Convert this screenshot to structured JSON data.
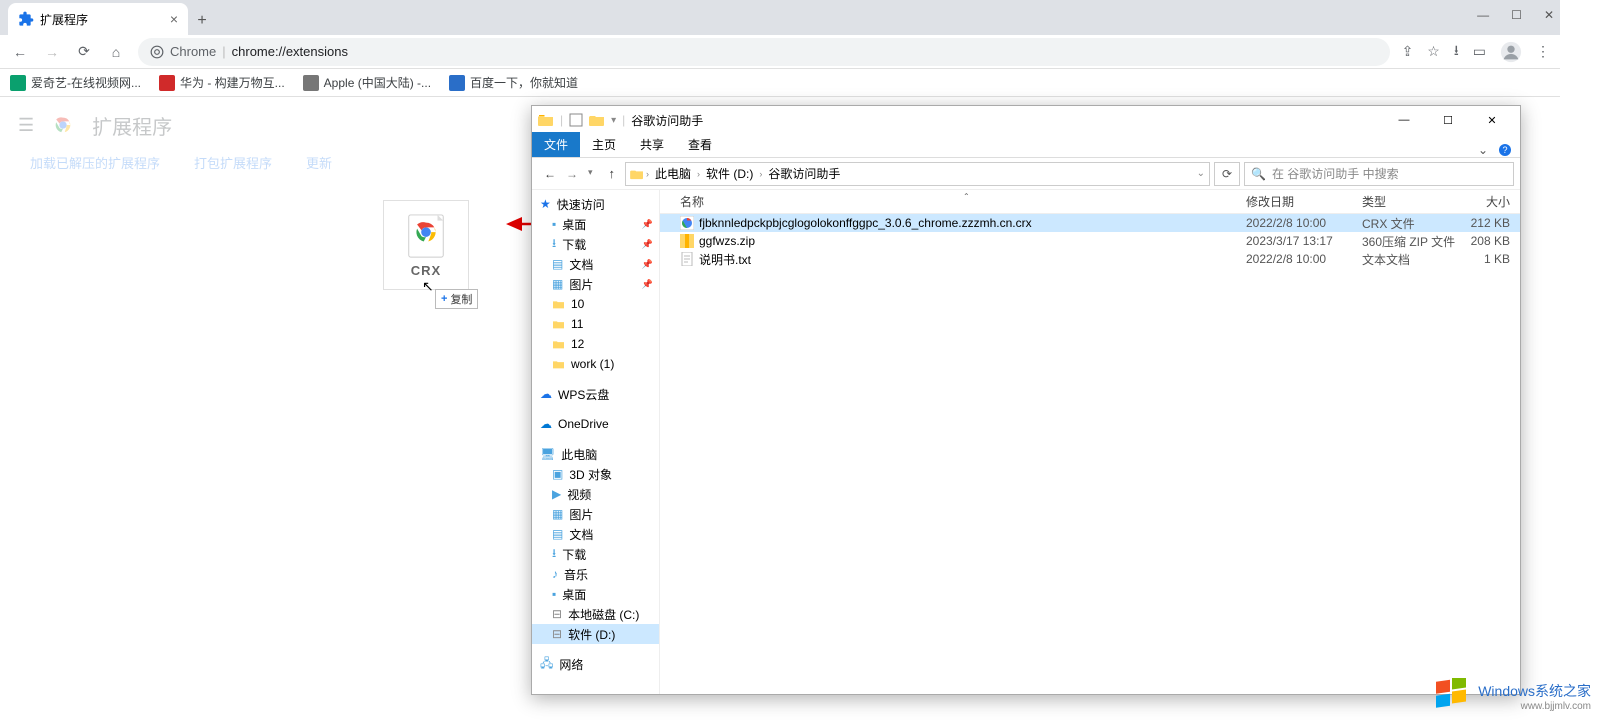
{
  "chrome": {
    "tab_title": "扩展程序",
    "omnibox_prefix": "Chrome",
    "omnibox_url": "chrome://extensions",
    "bookmarks": [
      {
        "label": "爱奇艺-在线视频网...",
        "color": "#0aa06e"
      },
      {
        "label": "华为 - 构建万物互...",
        "color": "#d02a2a"
      },
      {
        "label": "Apple (中国大陆) -...",
        "color": "#777"
      },
      {
        "label": "百度一下，你就知道",
        "color": "#2a6ec8"
      }
    ],
    "ext_page_title": "扩展程序",
    "ext_tabs": [
      "加载已解压的扩展程序",
      "打包扩展程序",
      "更新"
    ]
  },
  "drag": {
    "file_label": "CRX",
    "copy_tip": "复制"
  },
  "explorer": {
    "title": "谷歌访问助手",
    "ribbon": [
      "文件",
      "主页",
      "共享",
      "查看"
    ],
    "breadcrumb": [
      "此电脑",
      "软件 (D:)",
      "谷歌访问助手"
    ],
    "search_placeholder": "在 谷歌访问助手 中搜索",
    "columns": {
      "name": "名称",
      "date": "修改日期",
      "type": "类型",
      "size": "大小"
    },
    "sidebar": {
      "quick": "快速访问",
      "quick_items": [
        "桌面",
        "下载",
        "文档",
        "图片",
        "10",
        "11",
        "12",
        "work (1)"
      ],
      "wps": "WPS云盘",
      "onedrive": "OneDrive",
      "pc": "此电脑",
      "pc_items": [
        "3D 对象",
        "视频",
        "图片",
        "文档",
        "下载",
        "音乐",
        "桌面",
        "本地磁盘 (C:)",
        "软件 (D:)"
      ],
      "network": "网络"
    },
    "files": [
      {
        "name": "fjbknnledpckpbjcglogolokonffggpc_3.0.6_chrome.zzzmh.cn.crx",
        "date": "2022/2/8 10:00",
        "type": "CRX 文件",
        "size": "212 KB",
        "icon": "crx"
      },
      {
        "name": "ggfwzs.zip",
        "date": "2023/3/17 13:17",
        "type": "360压缩 ZIP 文件",
        "size": "208 KB",
        "icon": "zip"
      },
      {
        "name": "说明书.txt",
        "date": "2022/2/8 10:00",
        "type": "文本文档",
        "size": "1 KB",
        "icon": "txt"
      }
    ]
  },
  "watermark": {
    "brand": "Windows",
    "suffix": "系统之家",
    "url": "www.bjjmlv.com"
  }
}
